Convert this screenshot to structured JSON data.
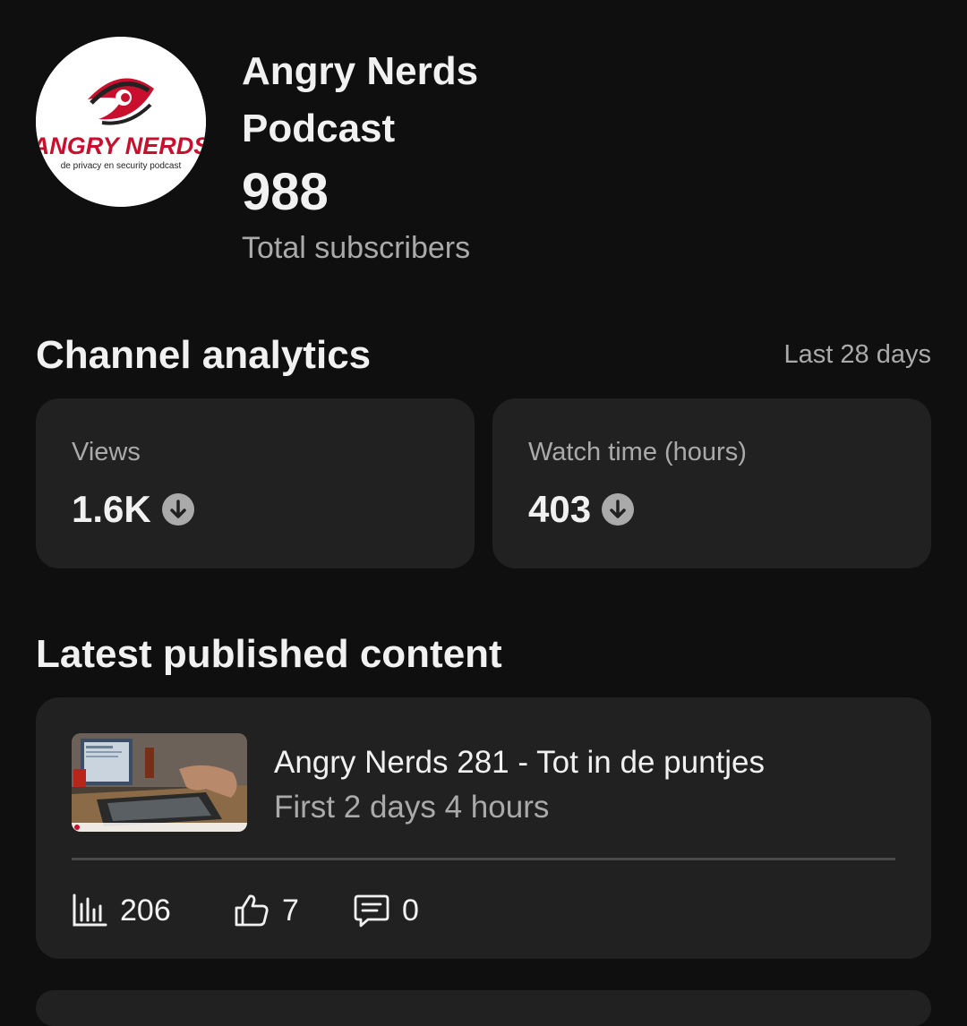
{
  "channel": {
    "name": "Angry Nerds Podcast",
    "subscriber_count": "988",
    "subscriber_label": "Total subscribers",
    "avatar_icon": "angry-nerds-logo",
    "avatar_logo_text": "ANGRY NERDS",
    "avatar_tagline": "de privacy en security podcast"
  },
  "analytics": {
    "title": "Channel analytics",
    "period": "Last 28 days",
    "metrics": [
      {
        "label": "Views",
        "value": "1.6K",
        "trend_icon": "arrow-down-circle-icon"
      },
      {
        "label": "Watch time (hours)",
        "value": "403",
        "trend_icon": "arrow-down-circle-icon"
      }
    ]
  },
  "latest": {
    "title": "Latest published content",
    "video": {
      "title": "Angry Nerds 281 - Tot in de puntjes",
      "subtitle": "First 2 days 4 hours",
      "stats": {
        "views": "206",
        "likes": "7",
        "comments": "0"
      }
    }
  },
  "colors": {
    "background": "#0f0f0f",
    "card": "#212121",
    "text_primary": "#f1f1f1",
    "text_secondary": "#aaaaaa",
    "logo_red": "#c8102e"
  }
}
